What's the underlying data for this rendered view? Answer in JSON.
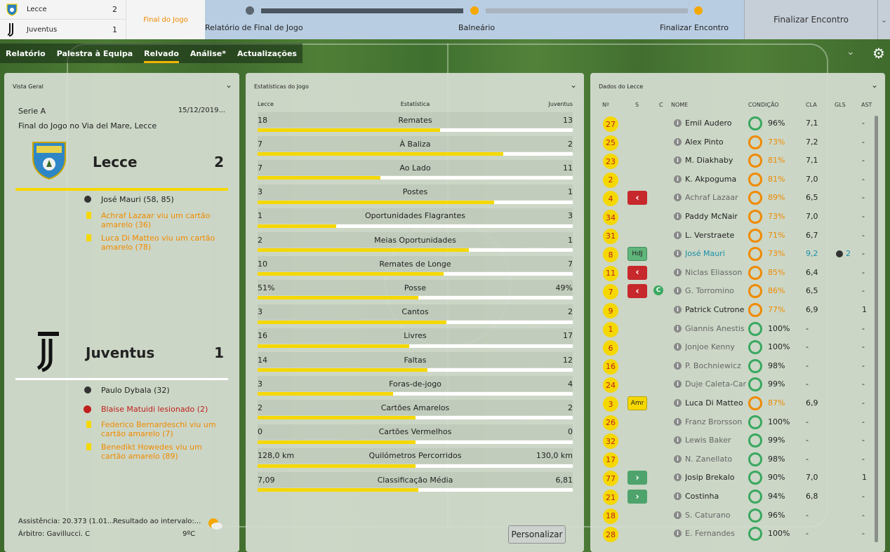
{
  "scoreboard": {
    "home": {
      "name": "Lecce",
      "score": "2"
    },
    "away": {
      "name": "Juventus",
      "score": "1"
    },
    "status": "Final do Jogo"
  },
  "progress": {
    "steps": [
      "Relatório de Final de Jogo",
      "Balneário",
      "Finalizar Encontro"
    ]
  },
  "finalize_button": "Finalizar Encontro",
  "nav": {
    "tabs": [
      "Relatório",
      "Palestra à Equipa",
      "Relvado",
      "Análise*",
      "Actualizações"
    ],
    "active": "Relvado"
  },
  "overview": {
    "title": "Vista Geral",
    "league": "Serie A",
    "date": "15/12/2019...",
    "venue": "Final do Jogo no Via del Mare, Lecce",
    "home": {
      "name": "Lecce",
      "score": "2",
      "events": [
        {
          "type": "goal",
          "text": "José Mauri (58, 85)"
        },
        {
          "type": "yellow",
          "text": "Achraf Lazaar viu um cartão amarelo (36)"
        },
        {
          "type": "yellow",
          "text": "Luca Di Matteo viu um cartão amarelo (78)"
        }
      ]
    },
    "away": {
      "name": "Juventus",
      "score": "1",
      "events": [
        {
          "type": "goal",
          "text": "Paulo Dybala (32)"
        },
        {
          "type": "injury",
          "text": "Blaise Matuidi lesionado (2)"
        },
        {
          "type": "yellow",
          "text": "Federico Bernardeschi viu um cartão amarelo (7)"
        },
        {
          "type": "yellow",
          "text": "Benedikt Howedes viu um cartão amarelo (89)"
        }
      ]
    },
    "attendance": "Assistência: 20.373 (1.01...",
    "halftime": "Resultado ao intervalo:...",
    "referee": "Árbitro: Gavillucci. C",
    "temperature": "9ºC"
  },
  "stats": {
    "title": "Estatísticas do Jogo",
    "col_home": "Lecce",
    "col_name": "Estatística",
    "col_away": "Juventus",
    "rows": [
      {
        "name": "Remates",
        "home": "18",
        "away": "13",
        "share": 0.58
      },
      {
        "name": "À Baliza",
        "home": "7",
        "away": "2",
        "share": 0.78
      },
      {
        "name": "Ao Lado",
        "home": "7",
        "away": "11",
        "share": 0.39
      },
      {
        "name": "Postes",
        "home": "3",
        "away": "1",
        "share": 0.75
      },
      {
        "name": "Oportunidades Flagrantes",
        "home": "1",
        "away": "3",
        "share": 0.25
      },
      {
        "name": "Meias Oportunidades",
        "home": "2",
        "away": "1",
        "share": 0.67
      },
      {
        "name": "Remates de Longe",
        "home": "10",
        "away": "7",
        "share": 0.59
      },
      {
        "name": "Posse",
        "home": "51%",
        "away": "49%",
        "share": 0.51
      },
      {
        "name": "Cantos",
        "home": "3",
        "away": "2",
        "share": 0.6
      },
      {
        "name": "Livres",
        "home": "16",
        "away": "17",
        "share": 0.48
      },
      {
        "name": "Faltas",
        "home": "14",
        "away": "12",
        "share": 0.54
      },
      {
        "name": "Foras-de-jogo",
        "home": "3",
        "away": "4",
        "share": 0.43
      },
      {
        "name": "Cartões Amarelos",
        "home": "2",
        "away": "2",
        "share": 0.5
      },
      {
        "name": "Cartões Vermelhos",
        "home": "0",
        "away": "0",
        "share": 0.5
      },
      {
        "name": "Quilómetros Percorridos",
        "home": "128,0 km",
        "away": "130,0 km",
        "share": 0.5
      },
      {
        "name": "Classificação Média",
        "home": "7,09",
        "away": "6,81",
        "share": 0.51
      }
    ],
    "customize_button": "Personalizar"
  },
  "squad": {
    "title": "Dados do Lecce",
    "headers": [
      "Nº",
      "S",
      "C",
      "NOME",
      "CONDIÇÃO",
      "CLA",
      "GLS",
      "AST"
    ],
    "players": [
      {
        "num": "27",
        "name": "Emil Audero",
        "cond": "96%",
        "cla": "7,1",
        "gls": "",
        "ast": "-"
      },
      {
        "num": "25",
        "name": "Alex Pinto",
        "cond": "73%",
        "cla": "7,2",
        "gls": "",
        "ast": "-"
      },
      {
        "num": "23",
        "name": "M. Diakhaby",
        "cond": "81%",
        "cla": "7,1",
        "gls": "",
        "ast": "-"
      },
      {
        "num": "2",
        "name": "K. Akpoguma",
        "cond": "81%",
        "cla": "7,0",
        "gls": "",
        "ast": "-"
      },
      {
        "num": "4",
        "s": "out",
        "name": "Achraf Lazaar",
        "cond": "89%",
        "cla": "6,5",
        "gls": "",
        "ast": "-"
      },
      {
        "num": "34",
        "name": "Paddy McNair",
        "cond": "73%",
        "cla": "7,0",
        "gls": "",
        "ast": "-"
      },
      {
        "num": "31",
        "name": "L. Verstraete",
        "cond": "71%",
        "cla": "6,7",
        "gls": "",
        "ast": "-"
      },
      {
        "num": "8",
        "tag": "HdJ",
        "name": "José Mauri",
        "cond": "73%",
        "cla": "9,2",
        "gls": "2",
        "ast": "-"
      },
      {
        "num": "11",
        "s": "out",
        "name": "Niclas Eliasson",
        "cond": "85%",
        "cla": "6,4",
        "gls": "",
        "ast": "-"
      },
      {
        "num": "7",
        "s": "out",
        "cap": "C",
        "name": "G. Torromino",
        "cond": "86%",
        "cla": "6,5",
        "gls": "",
        "ast": "-"
      },
      {
        "num": "9",
        "name": "Patrick Cutrone",
        "cond": "77%",
        "cla": "6,9",
        "gls": "",
        "ast": "1"
      },
      {
        "num": "1",
        "name": "Giannis Anestis",
        "cond": "100%",
        "cla": "-",
        "gls": "",
        "ast": "-"
      },
      {
        "num": "6",
        "name": "Jonjoe Kenny",
        "cond": "100%",
        "cla": "-",
        "gls": "",
        "ast": "-"
      },
      {
        "num": "16",
        "name": "P. Bochniewicz",
        "cond": "98%",
        "cla": "-",
        "gls": "",
        "ast": "-"
      },
      {
        "num": "24",
        "name": "Duje Caleta-Car",
        "cond": "99%",
        "cla": "-",
        "gls": "",
        "ast": "-"
      },
      {
        "num": "3",
        "tag": "Amr",
        "name": "Luca Di Matteo",
        "cond": "87%",
        "cla": "6,9",
        "gls": "",
        "ast": "-"
      },
      {
        "num": "26",
        "name": "Franz Brorsson",
        "cond": "100%",
        "cla": "-",
        "gls": "",
        "ast": "-"
      },
      {
        "num": "32",
        "name": "Lewis Baker",
        "cond": "99%",
        "cla": "-",
        "gls": "",
        "ast": "-"
      },
      {
        "num": "17",
        "name": "N. Zanellato",
        "cond": "98%",
        "cla": "-",
        "gls": "",
        "ast": "-"
      },
      {
        "num": "77",
        "s": "in",
        "name": "Josip Brekalo",
        "cond": "90%",
        "cla": "7,0",
        "gls": "",
        "ast": "1"
      },
      {
        "num": "21",
        "s": "in",
        "name": "Costinha",
        "cond": "94%",
        "cla": "6,8",
        "gls": "",
        "ast": "-"
      },
      {
        "num": "18",
        "name": "S. Caturano",
        "cond": "96%",
        "cla": "-",
        "gls": "",
        "ast": "-"
      },
      {
        "num": "28",
        "name": "E. Fernandes",
        "cond": "100%",
        "cla": "-",
        "gls": "",
        "ast": "-"
      }
    ]
  },
  "colors": {
    "accent": "#f5d800",
    "orange": "#f08a00",
    "red": "#c0201c",
    "green": "#3aa860",
    "highlight": "#1a8fa8"
  }
}
